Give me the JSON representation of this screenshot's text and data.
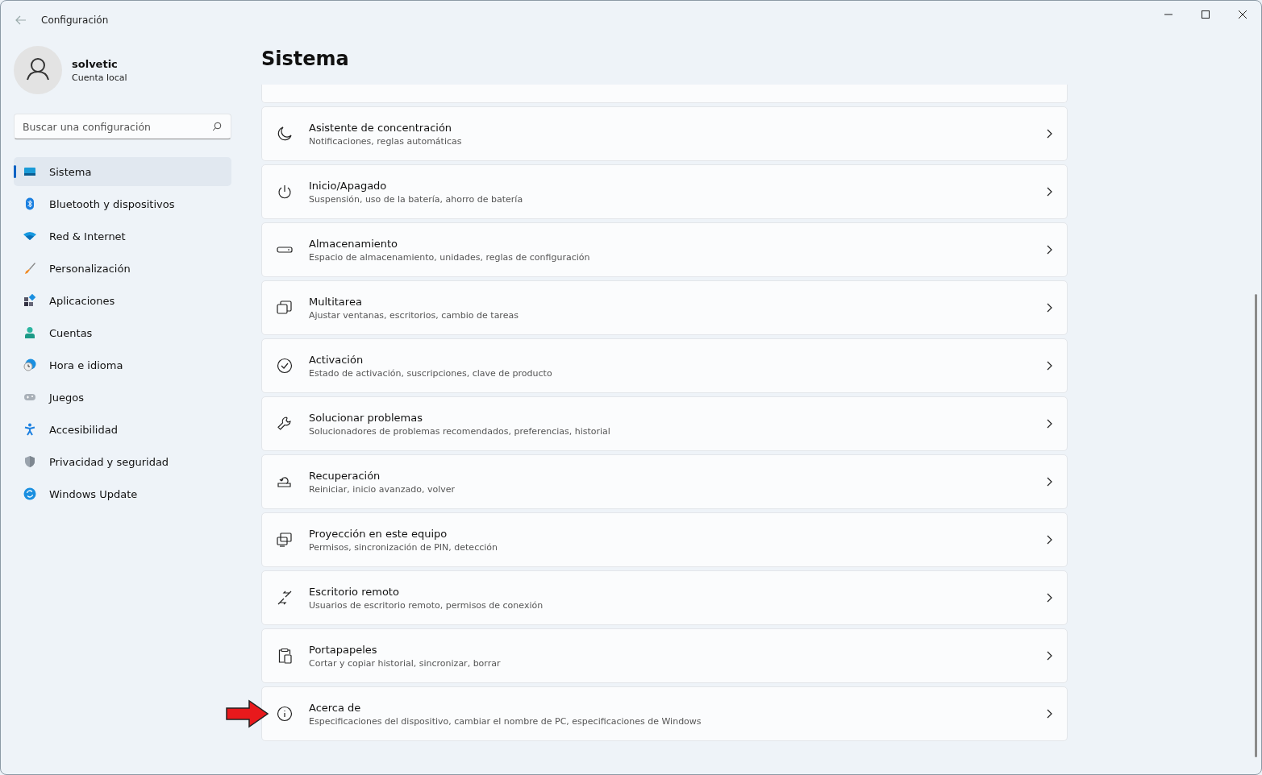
{
  "window": {
    "title": "Configuración"
  },
  "account": {
    "name": "solvetic",
    "type": "Cuenta local"
  },
  "search": {
    "placeholder": "Buscar una configuración"
  },
  "sidebar": {
    "items": [
      {
        "label": "Sistema",
        "selected": true
      },
      {
        "label": "Bluetooth y dispositivos",
        "selected": false
      },
      {
        "label": "Red & Internet",
        "selected": false
      },
      {
        "label": "Personalización",
        "selected": false
      },
      {
        "label": "Aplicaciones",
        "selected": false
      },
      {
        "label": "Cuentas",
        "selected": false
      },
      {
        "label": "Hora e idioma",
        "selected": false
      },
      {
        "label": "Juegos",
        "selected": false
      },
      {
        "label": "Accesibilidad",
        "selected": false
      },
      {
        "label": "Privacidad y seguridad",
        "selected": false
      },
      {
        "label": "Windows Update",
        "selected": false
      }
    ]
  },
  "page": {
    "title": "Sistema",
    "settings": [
      {
        "title": "Asistente de concentración",
        "description": "Notificaciones, reglas automáticas"
      },
      {
        "title": "Inicio/Apagado",
        "description": "Suspensión, uso de la batería, ahorro de batería"
      },
      {
        "title": "Almacenamiento",
        "description": "Espacio de almacenamiento, unidades, reglas de configuración"
      },
      {
        "title": "Multitarea",
        "description": "Ajustar ventanas, escritorios, cambio de tareas"
      },
      {
        "title": "Activación",
        "description": "Estado de activación, suscripciones, clave de producto"
      },
      {
        "title": "Solucionar problemas",
        "description": "Solucionadores de problemas recomendados, preferencias, historial"
      },
      {
        "title": "Recuperación",
        "description": "Reiniciar, inicio avanzado, volver"
      },
      {
        "title": "Proyección en este equipo",
        "description": "Permisos, sincronización de PIN, detección"
      },
      {
        "title": "Escritorio remoto",
        "description": "Usuarios de escritorio remoto, permisos de conexión"
      },
      {
        "title": "Portapapeles",
        "description": "Cortar y copiar historial, sincronizar, borrar"
      },
      {
        "title": "Acerca de",
        "description": "Especificaciones del dispositivo, cambiar el nombre de PC, especificaciones de Windows"
      }
    ]
  }
}
